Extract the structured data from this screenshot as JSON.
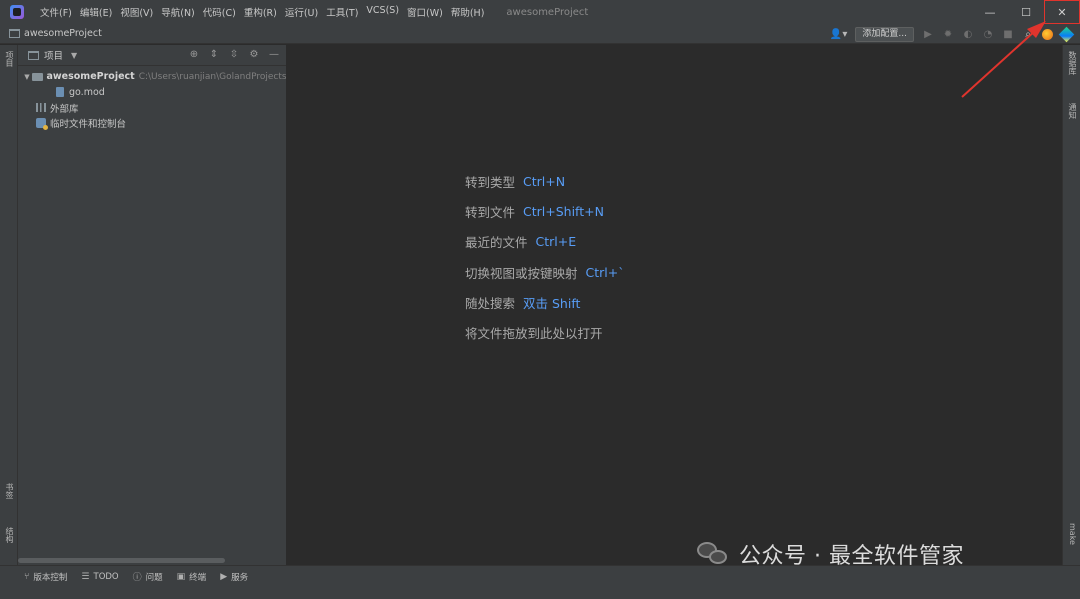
{
  "window": {
    "title": "awesomeProject",
    "controls": {
      "minimize": "—",
      "maximize": "☐",
      "close": "✕"
    }
  },
  "menu": [
    "文件(F)",
    "编辑(E)",
    "视图(V)",
    "导航(N)",
    "代码(C)",
    "重构(R)",
    "运行(U)",
    "工具(T)",
    "VCS(S)",
    "窗口(W)",
    "帮助(H)"
  ],
  "navbar": {
    "project": "awesomeProject",
    "add_config": "添加配置..."
  },
  "left_strip": {
    "project": "项目",
    "bookmarks": "书签",
    "structure": "结构"
  },
  "right_strip": {
    "database": "数据库",
    "notifications": "通知",
    "make": "make"
  },
  "project_panel": {
    "title": "项目",
    "tree": [
      {
        "name": "awesomeProject",
        "path": "C:\\Users\\ruanjian\\GolandProjects\\"
      },
      {
        "name": "go.mod"
      },
      {
        "name": "外部库"
      },
      {
        "name": "临时文件和控制台"
      }
    ]
  },
  "editor": {
    "hints": [
      {
        "label": "转到类型",
        "key": "Ctrl+N"
      },
      {
        "label": "转到文件",
        "key": "Ctrl+Shift+N"
      },
      {
        "label": "最近的文件",
        "key": "Ctrl+E"
      },
      {
        "label": "切换视图或按键映射",
        "key": "Ctrl+`"
      },
      {
        "label": "随处搜索",
        "key": "双击 Shift"
      },
      {
        "label": "将文件拖放到此处以打开",
        "key": ""
      }
    ]
  },
  "bottom_tabs": [
    {
      "icon": "version-control-icon",
      "glyph": "⑂",
      "label": "版本控制"
    },
    {
      "icon": "todo-icon",
      "glyph": "☰",
      "label": "TODO"
    },
    {
      "icon": "problems-icon",
      "glyph": "ⓘ",
      "label": "问题"
    },
    {
      "icon": "terminal-icon",
      "glyph": "▣",
      "label": "终端"
    },
    {
      "icon": "services-icon",
      "glyph": "▶",
      "label": "服务"
    }
  ],
  "watermark": {
    "text": "公众号 · 最全软件管家"
  },
  "colors": {
    "accent_key": "#589df6",
    "annotation": "#e0342d",
    "background": "#2b2b2b",
    "panel": "#3c3f41"
  }
}
